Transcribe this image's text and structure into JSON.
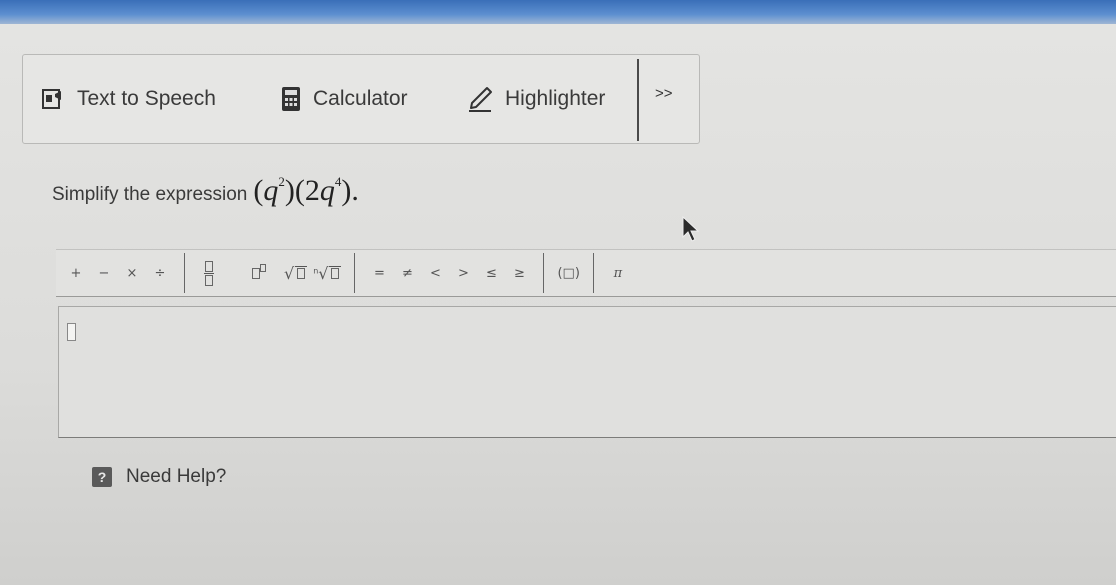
{
  "toolbar": {
    "text_to_speech_label": "Text to Speech",
    "calculator_label": "Calculator",
    "highlighter_label": "Highlighter",
    "more_label": ">>"
  },
  "question": {
    "prompt": "Simplify the expression",
    "expression": {
      "base1": "q",
      "exp1": "2",
      "coef2": "2",
      "base2": "q",
      "exp2": "4",
      "period": "."
    }
  },
  "equation_editor": {
    "plus": "+",
    "minus": "−",
    "times": "×",
    "divide": "÷",
    "equals": "=",
    "not_equal": "≠",
    "less": "<",
    "greater": ">",
    "less_equal": "≤",
    "greater_equal": "≥",
    "parens": "(□)",
    "pi": "π",
    "nth_root_index": "n"
  },
  "help": {
    "label": "Need Help?",
    "icon_glyph": "?"
  },
  "colors": {
    "top_bar": "#3a6fb8",
    "page_background": "#dedede",
    "help_icon": "#5a5a5a"
  },
  "icons": {
    "text_to_speech": "speaker-page-icon",
    "calculator": "calculator-icon",
    "highlighter": "highlighter-pen-icon",
    "help": "question-mark-icon",
    "pointer": "mouse-pointer-icon"
  }
}
